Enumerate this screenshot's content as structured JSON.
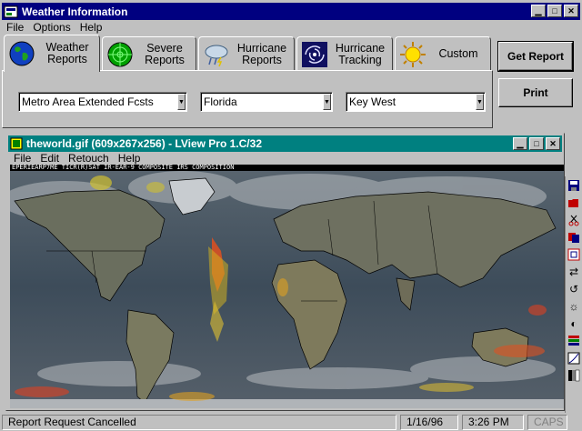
{
  "app": {
    "title": "Weather Information",
    "menu": [
      "File",
      "Options",
      "Help"
    ],
    "window_buttons": [
      "minimize",
      "maximize",
      "close"
    ]
  },
  "tabs": [
    {
      "line1": "Weather",
      "line2": "Reports",
      "icon": "globe-icon",
      "active": true
    },
    {
      "line1": "Severe",
      "line2": "Reports",
      "icon": "radar-icon",
      "active": false
    },
    {
      "line1": "Hurricane",
      "line2": "Reports",
      "icon": "storm-cloud-icon",
      "active": false
    },
    {
      "line1": "Hurricane",
      "line2": "Tracking",
      "icon": "hurricane-icon",
      "active": false
    },
    {
      "line1": "Custom",
      "line2": "",
      "icon": "sun-icon",
      "active": false
    }
  ],
  "selectors": {
    "category": "Metro Area Extended Fcsts",
    "state": "Florida",
    "city": "Key West"
  },
  "buttons": {
    "get_report": "Get Report",
    "print": "Print"
  },
  "viewer": {
    "title": "theworld.gif (609x267x256) - LView Pro 1.C/32",
    "menu": [
      "File",
      "Edit",
      "Retouch",
      "Help"
    ],
    "image_header": "EPERIEARP7ME TICR(R)SAT IR-EAR-9 COMPOSITE  IRS COMPOSITION"
  },
  "toolbar_icons": [
    "save-icon",
    "open-icon",
    "cut-icon",
    "copy-icon",
    "paste-icon",
    "swap-icon",
    "rotate-icon",
    "brightness-icon",
    "contrast-icon",
    "palette-icon",
    "gamma-icon",
    "grayscale-icon"
  ],
  "status": {
    "message": "Report Request Cancelled",
    "date": "1/16/96",
    "time": "3:26 PM",
    "caps": "CAPS"
  },
  "colors": {
    "title_bar": "#000080",
    "viewer_title_bar": "#008080",
    "face": "#c0c0c0"
  }
}
